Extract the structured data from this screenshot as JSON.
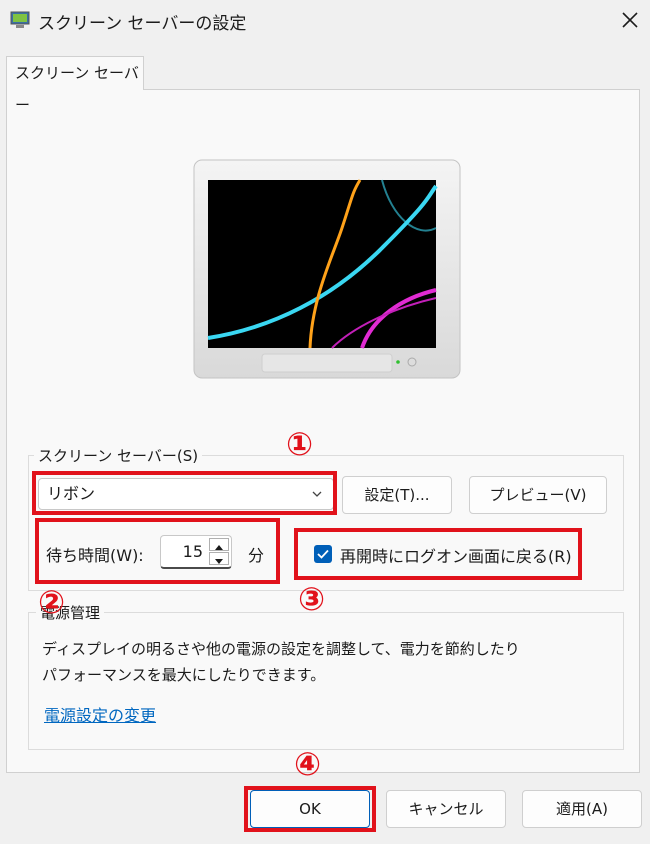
{
  "window": {
    "title": "スクリーン セーバーの設定",
    "close_icon": "close-icon"
  },
  "tab": {
    "label": "スクリーン セーバー"
  },
  "screensaver": {
    "group_label": "スクリーン セーバー(S)",
    "selected": "リボン",
    "settings_button": "設定(T)...",
    "preview_button": "プレビュー(V)",
    "wait_label": "待ち時間(W):",
    "wait_value": "15",
    "wait_unit": "分",
    "resume_label": "再開時にログオン画面に戻る(R)",
    "resume_checked": true
  },
  "power": {
    "group_label": "電源管理",
    "description_line1": "ディスプレイの明るさや他の電源の設定を調整して、電力を節約したり",
    "description_line2": "パフォーマンスを最大にしたりできます。",
    "link": "電源設定の変更"
  },
  "buttons": {
    "ok": "OK",
    "cancel": "キャンセル",
    "apply": "適用(A)"
  },
  "annotations": {
    "n1": "①",
    "n2": "②",
    "n3": "③",
    "n4": "④",
    "color": "#e1121b"
  }
}
